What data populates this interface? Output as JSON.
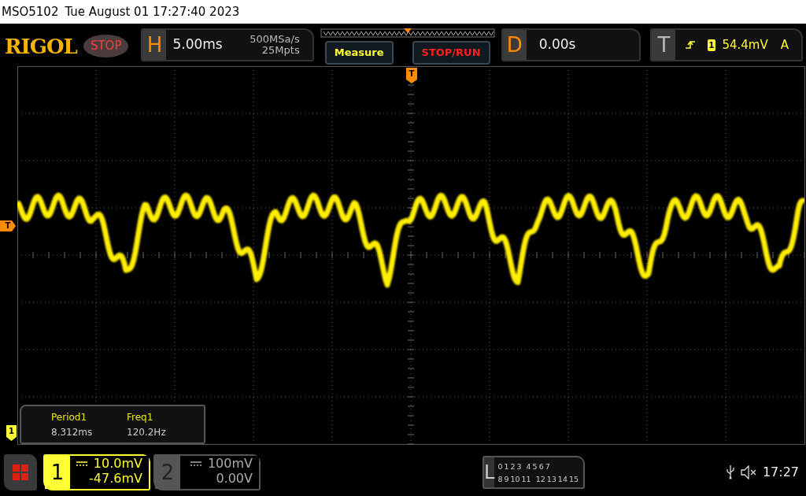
{
  "title_bar": {
    "model": "MSO5102",
    "datetime": "Tue August 01 17:27:40 2023"
  },
  "toolbar": {
    "logo": "RIGOL",
    "run_state": "STOP",
    "horizontal": {
      "letter": "H",
      "timebase": "5.00ms",
      "sample_rate": "500MSa/s",
      "memory_depth": "25Mpts"
    },
    "buttons": [
      {
        "label": "Measure",
        "kind": "measure"
      },
      {
        "label": "STOP/RUN",
        "kind": "stoprun"
      }
    ],
    "delay": {
      "letter": "D",
      "value": "0.00s"
    },
    "trigger": {
      "letter": "T",
      "source": "1",
      "level": "54.4mV",
      "mode": "A"
    }
  },
  "markers": {
    "trigger_position": "T",
    "trigger_level": "T",
    "channel": "1"
  },
  "measurements": [
    {
      "label": "Period1",
      "value": "8.312ms"
    },
    {
      "label": "Freq1",
      "value": "120.2Hz"
    }
  ],
  "channels": [
    {
      "number": "1",
      "scale": "10.0mV",
      "offset": "-47.6mV",
      "on": true
    },
    {
      "number": "2",
      "scale": "100mV",
      "offset": "0.00V",
      "on": false
    }
  ],
  "logic": {
    "letter": "L",
    "row_1": [
      "0",
      "1",
      "2",
      "3",
      "4",
      "5",
      "6",
      "7"
    ],
    "row_2": [
      "8",
      "9",
      "10",
      "11",
      "12",
      "13",
      "14",
      "15"
    ]
  },
  "status_bar": {
    "clock": "17:27"
  }
}
